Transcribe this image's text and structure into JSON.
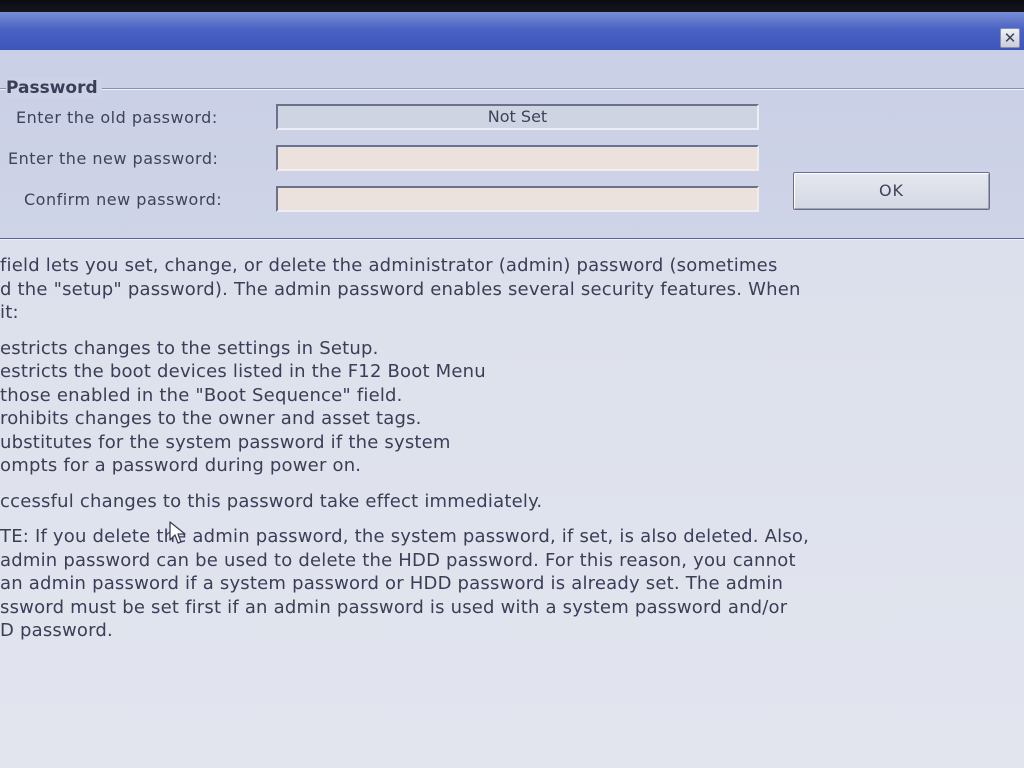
{
  "window": {
    "close_glyph": "✕"
  },
  "password_group": {
    "title": "Password",
    "old_label": "Enter the old password:",
    "old_value": "Not Set",
    "new_label": "Enter the new password:",
    "new_value": "",
    "confirm_label": "Confirm new password:",
    "confirm_value": "",
    "ok_label": "OK"
  },
  "help": {
    "intro": [
      "field lets you set, change, or delete the administrator (admin) password (sometimes",
      "d the \"setup\" password).  The admin password enables several security features. When",
      "it:"
    ],
    "features": [
      "estricts changes to the settings in Setup.",
      "estricts the boot devices listed in the F12 Boot Menu",
      " those enabled in the \"Boot Sequence\" field.",
      "rohibits changes to the owner and asset tags.",
      "ubstitutes for the system password if the system",
      "ompts for a password during power on."
    ],
    "success": "ccessful changes to this password take effect immediately.",
    "note": [
      "TE: If you delete the admin password, the system password, if set, is also deleted. Also,",
      " admin password can be used to delete the HDD password.  For this reason, you cannot",
      " an admin password if a system password or HDD password is already set. The admin",
      "ssword must be set first if an admin password is used with a system password and/or",
      "D password."
    ]
  },
  "colors": {
    "titlebar": "#4a62c4",
    "window_bg": "#dde1ec",
    "text": "#3a3e56"
  },
  "icons": {
    "close": "close-icon",
    "cursor": "mouse-cursor-icon"
  }
}
